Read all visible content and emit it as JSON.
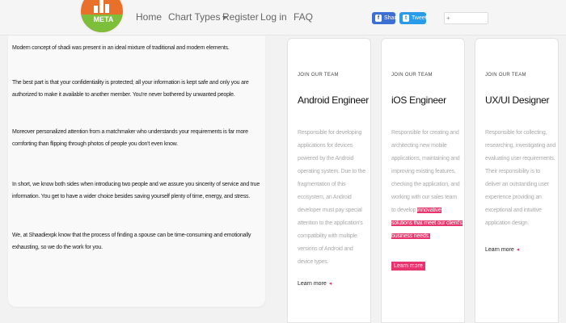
{
  "brand": {
    "logo_text": "META"
  },
  "nav": {
    "items": [
      {
        "label": "Home"
      },
      {
        "label": "Chart Types"
      },
      {
        "label": "Register"
      },
      {
        "label": "Log in"
      },
      {
        "label": "FAQ"
      }
    ]
  },
  "social": {
    "facebook_label": "Share",
    "twitter_label": "Tweet",
    "addthis_label": "+"
  },
  "left": {
    "paragraphs": [
      "Modern concept of shadi was present in an ideal mixture of traditional and modern elements.",
      "The best part is that your confidentiality is protected; all your information is kept safe and only you are authorized to make it available to another member. You're never bothered by unwanted people.",
      "Moreover personalized attention from a matchmaker who understands your requirements is far more comforting than flipping through photos of people you don't even know.",
      "In short, we know both sides when introducing two people and we assure you sincerity of service and true information. You get to have a wider choice besides saving yourself plenty of time, energy, and stress.",
      "We, at Shaadiexpk know that the process of finding a spouse can be time-consuming and emotionally exhausting, so we do the work for you."
    ]
  },
  "jobs": [
    {
      "kicker": "JOIN OUR TEAM",
      "title": "Android Engineer",
      "description": "Responsible for developing applications for devices powered by the Android operating system. Due to the fragmentation of this ecosystem, an Android developer must pay special attention to the application's compatibility with multiple versions of Android and device types.",
      "more": "Learn more"
    },
    {
      "kicker": "JOIN OUR TEAM",
      "title": "iOS Engineer",
      "description_plain": "Responsible for creating and architecting new mobile applications, maintaining and improving existing features, checking the application, and working with our sales team to develop",
      "description_highlight": "innovative solutions that meet our client's business needs.",
      "more": "Learn more"
    },
    {
      "kicker": "JOIN OUR TEAM",
      "title": "UX/UI Designer",
      "description": "Responsible for collecting, researching, investigating and evaluating user requirements. Their responsibility is to deliver an outstanding user experience providing an exceptional and intuitive application design.",
      "more": "Learn more"
    }
  ],
  "colors": {
    "accent": "#e8356f",
    "logo_orange": "#e8702a",
    "logo_green": "#7dbf3b"
  }
}
